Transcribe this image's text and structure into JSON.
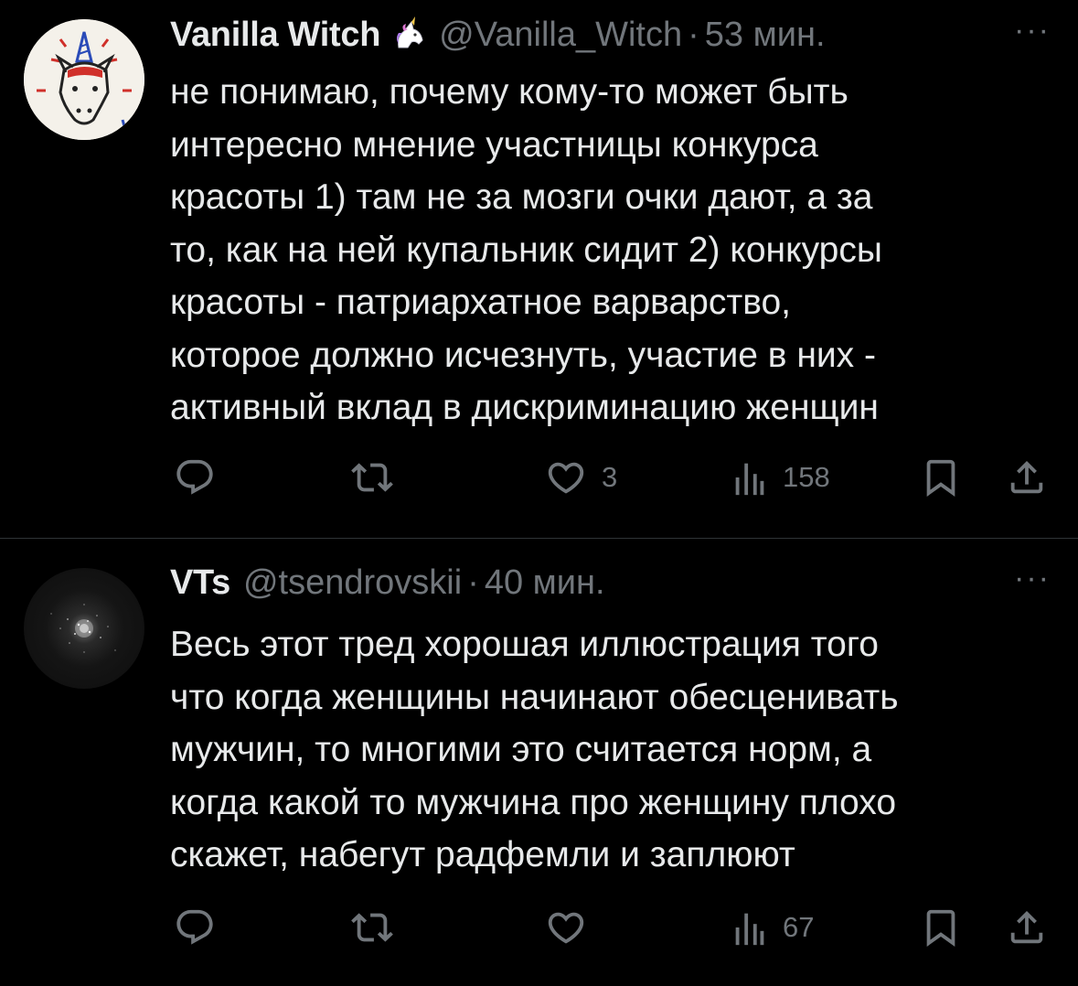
{
  "tweets": [
    {
      "display_name": "Vanilla Witch",
      "badge_icon": "unicorn-emoji-icon",
      "badge_glyph": "🦄",
      "handle": "@Vanilla_Witch",
      "separator": "·",
      "time": "53 мин.",
      "more": "···",
      "text": "не понимаю, почему кому-то может быть\nинтересно мнение участницы конкурса\nкрасоты 1) там не за мозги очки дают, а за\nто, как на ней купальник сидит 2) конкурсы\nкрасоты - патриархатное варварство,\nкоторое должно исчезнуть, участие в них -\nактивный вклад в дискриминацию женщин",
      "actions": {
        "reply_count": "",
        "retweet_count": "",
        "like_count": "3",
        "view_count": "158"
      }
    },
    {
      "display_name": "VTs",
      "handle": "@tsendrovskii",
      "separator": "·",
      "time": "40 мин.",
      "more": "···",
      "text": "Весь этот тред хорошая иллюстрация того\nчто когда женщины начинают обесценивать\nмужчин, то многими это считается норм, а\nкогда какой то мужчина про женщину плохо\nскажет, набегут радфемли и заплюют",
      "actions": {
        "reply_count": "",
        "retweet_count": "",
        "like_count": "",
        "view_count": "67"
      }
    }
  ],
  "colors": {
    "background": "#000000",
    "text_primary": "#e7e9ea",
    "text_secondary": "#71767b",
    "divider": "#2f3336"
  }
}
